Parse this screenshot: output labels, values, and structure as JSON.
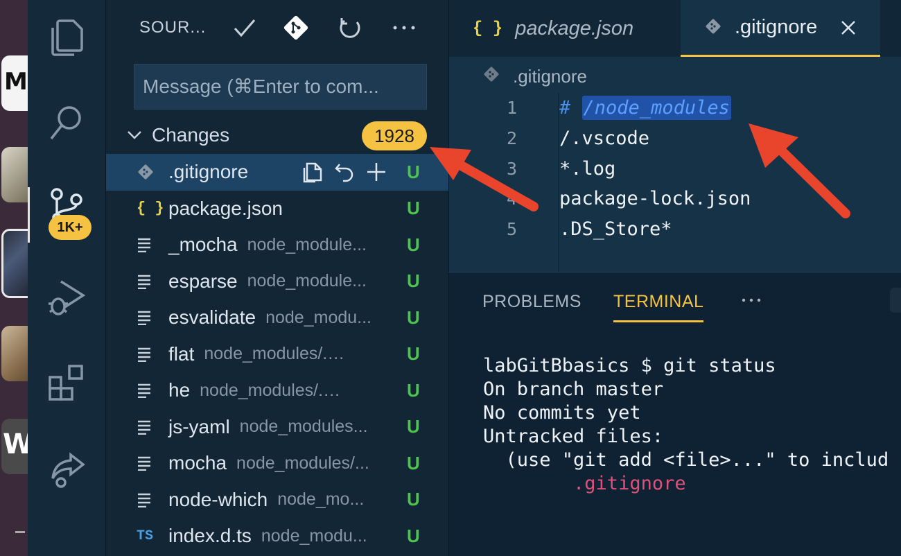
{
  "dock": {
    "m_letter": "M",
    "w_letter": "W"
  },
  "activity": {
    "source_control_badge": "1K+"
  },
  "sidebar": {
    "title": "SOUR...",
    "message_placeholder": "Message (⌘Enter to com...",
    "changes_label": "Changes",
    "changes_count": "1928",
    "files": [
      {
        "name": ".gitignore",
        "path": "",
        "status": "U",
        "icon": "git"
      },
      {
        "name": "package.json",
        "path": "",
        "status": "U",
        "icon": "json"
      },
      {
        "name": "_mocha",
        "path": "node_module...",
        "status": "U",
        "icon": "lines"
      },
      {
        "name": "esparse",
        "path": "node_module...",
        "status": "U",
        "icon": "lines"
      },
      {
        "name": "esvalidate",
        "path": "node_modu...",
        "status": "U",
        "icon": "lines"
      },
      {
        "name": "flat",
        "path": "node_modules/.bin",
        "status": "U",
        "icon": "lines"
      },
      {
        "name": "he",
        "path": "node_modules/.bin",
        "status": "U",
        "icon": "lines"
      },
      {
        "name": "js-yaml",
        "path": "node_modules...",
        "status": "U",
        "icon": "lines"
      },
      {
        "name": "mocha",
        "path": "node_modules/...",
        "status": "U",
        "icon": "lines"
      },
      {
        "name": "node-which",
        "path": "node_mo...",
        "status": "U",
        "icon": "lines"
      },
      {
        "name": "index.d.ts",
        "path": "node_modu...",
        "status": "U",
        "icon": "ts"
      }
    ]
  },
  "editor": {
    "tabs": [
      {
        "label": "package.json",
        "icon_text": "{ }"
      },
      {
        "label": ".gitignore"
      }
    ],
    "breadcrumb": ".gitignore",
    "lines": [
      {
        "n": "1",
        "comment_hash": "#",
        "highlight": "/node_modules"
      },
      {
        "n": "2",
        "text": "/.vscode"
      },
      {
        "n": "3",
        "text": "*.log"
      },
      {
        "n": "4",
        "text": "package-lock.json"
      },
      {
        "n": "5",
        "text": ".DS_Store*"
      }
    ]
  },
  "panel": {
    "tab_problems": "PROBLEMS",
    "tab_terminal": "TERMINAL",
    "more": "···",
    "terminal_lines": [
      "labGitBbasics $ git status",
      "On branch master",
      "",
      "No commits yet",
      "",
      "Untracked files:",
      "  (use \"git add <file>...\" to includ",
      "",
      "        .gitignore"
    ]
  },
  "colors": {
    "accent": "#f5c242",
    "untracked": "#4fc34f",
    "arrow": "#e8452c"
  },
  "file_icons": {
    "json": "{ }",
    "ts": "TS"
  }
}
